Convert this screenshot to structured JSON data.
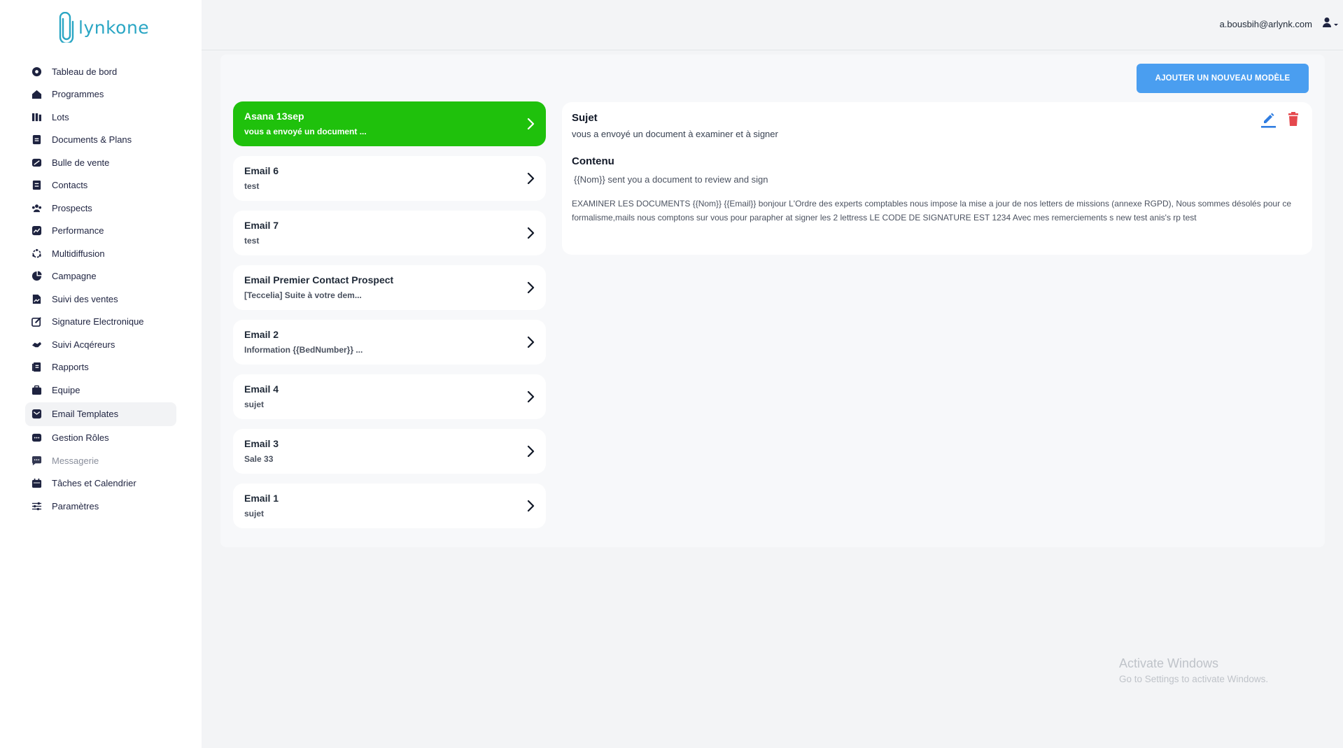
{
  "brand": {
    "name": "lynkone",
    "color": "#2aa6c4"
  },
  "user": {
    "email": "a.bousbih@arlynk.com"
  },
  "sidebar": {
    "items": [
      {
        "label": "Tableau de bord",
        "icon": "dashboard-icon"
      },
      {
        "label": "Programmes",
        "icon": "home-icon"
      },
      {
        "label": "Lots",
        "icon": "lots-icon"
      },
      {
        "label": "Documents & Plans",
        "icon": "document-icon"
      },
      {
        "label": "Bulle de vente",
        "icon": "sales-bubble-icon"
      },
      {
        "label": "Contacts",
        "icon": "contacts-icon"
      },
      {
        "label": "Prospects",
        "icon": "prospects-icon"
      },
      {
        "label": "Performance",
        "icon": "chart-icon"
      },
      {
        "label": "Multidiffusion",
        "icon": "broadcast-icon"
      },
      {
        "label": "Campagne",
        "icon": "pie-icon"
      },
      {
        "label": "Suivi des ventes",
        "icon": "sales-tracking-icon"
      },
      {
        "label": "Signature Electronique",
        "icon": "signature-icon"
      },
      {
        "label": "Suivi Acqéreurs",
        "icon": "handshake-icon"
      },
      {
        "label": "Rapports",
        "icon": "reports-icon"
      },
      {
        "label": "Equipe",
        "icon": "briefcase-icon"
      },
      {
        "label": "Email Templates",
        "icon": "mail-icon",
        "active": true
      },
      {
        "label": "Gestion Rôles",
        "icon": "roles-icon"
      },
      {
        "label": "Messagerie",
        "icon": "chat-icon",
        "muted": true
      },
      {
        "label": "Tâches et Calendrier",
        "icon": "calendar-icon"
      },
      {
        "label": "Paramètres",
        "icon": "settings-icon"
      }
    ]
  },
  "toolbar": {
    "add_label": "AJOUTER UN NOUVEAU MODÈLE",
    "add_color": "#4a9ef0"
  },
  "templates": [
    {
      "name": "Asana 13sep",
      "subject": "vous a envoyé un document ...",
      "selected": true
    },
    {
      "name": "Email 6",
      "subject": "test"
    },
    {
      "name": "Email 7",
      "subject": "test"
    },
    {
      "name": "Email Premier Contact Prospect",
      "subject": "[Teccelia] Suite à votre dem..."
    },
    {
      "name": "Email 2",
      "subject": "Information {{BedNumber}} ..."
    },
    {
      "name": "Email 4",
      "subject": "sujet"
    },
    {
      "name": "Email 3",
      "subject": "Sale 33"
    },
    {
      "name": "Email 1",
      "subject": "sujet"
    }
  ],
  "selected_color": "#1fc10c",
  "detail": {
    "subject_title": "Sujet",
    "subject": "vous a envoyé un document à examiner et à signer",
    "content_title": "Contenu",
    "content_line1": "{{Nom}} sent you a document to review and sign",
    "content_body": "EXAMINER LES DOCUMENTS  {{Nom}} {{Email}} bonjour L'Ordre des experts comptables nous impose la mise a jour de nos letters de missions (annexe RGPD), Nous sommes désolés pour ce formalisme,mails nous comptons sur vous pour parapher at signer les 2 lettress LE CODE DE SIGNATURE EST 1234 Avec mes remerciements s new test anis's rp test",
    "edit_color": "#2f7de1",
    "delete_color": "#e5484d"
  },
  "watermark": {
    "title": "Activate Windows",
    "subtitle": "Go to Settings to activate Windows."
  }
}
